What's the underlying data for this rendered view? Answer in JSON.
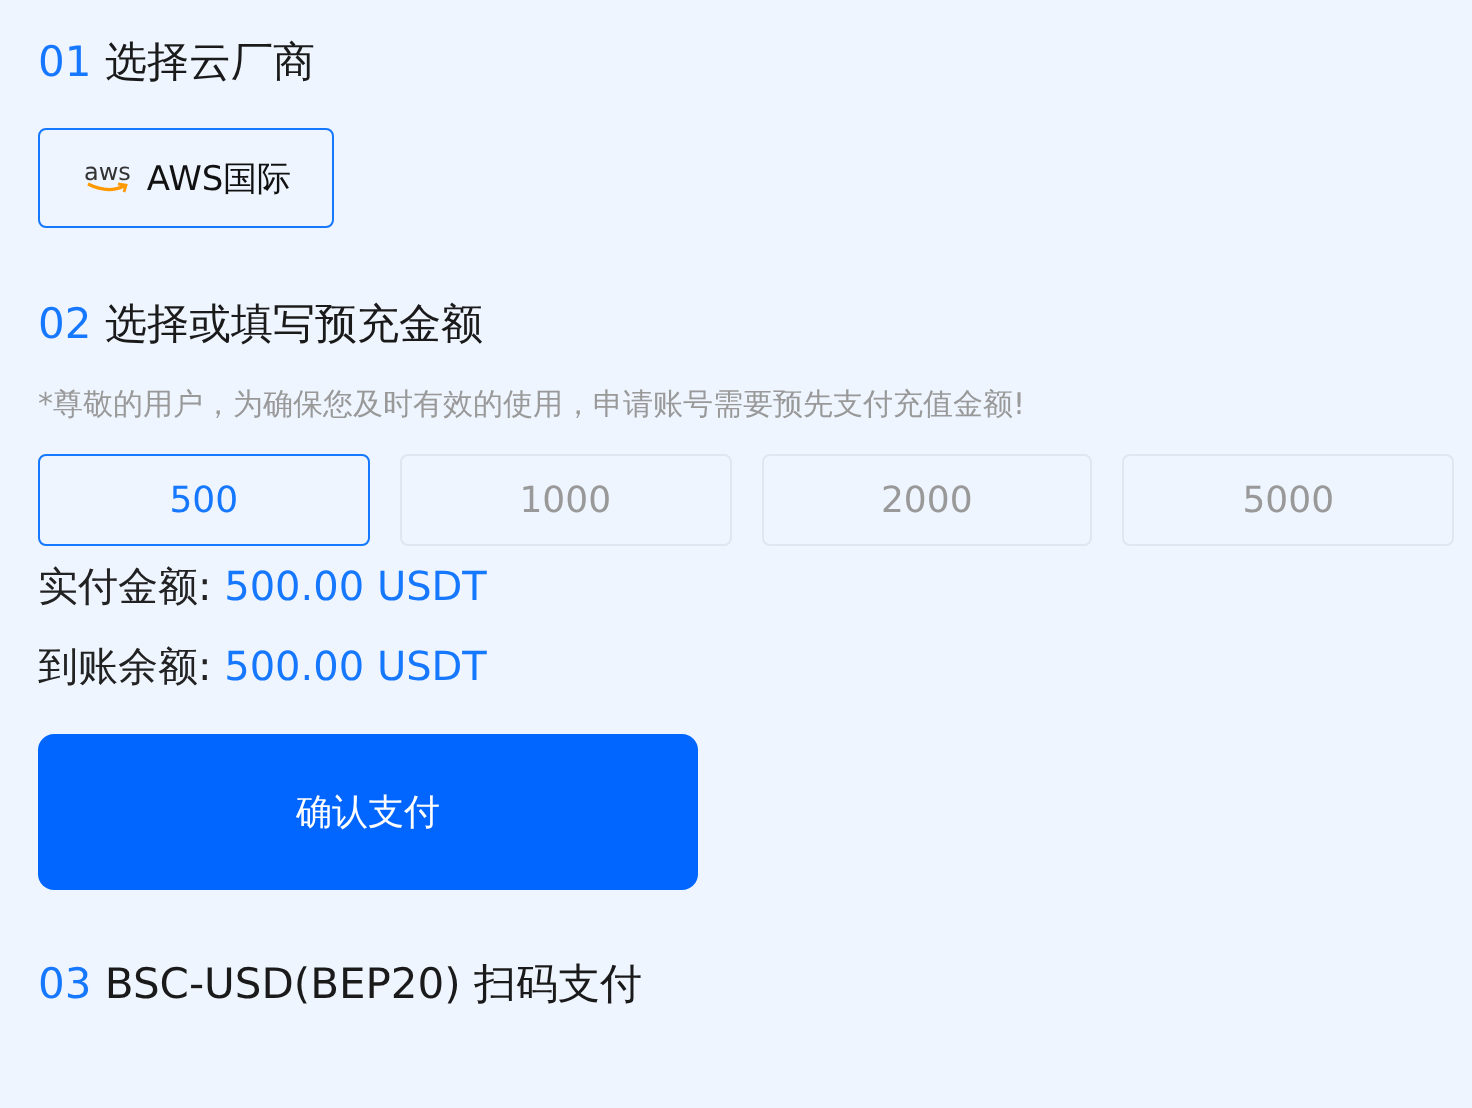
{
  "sections": [
    {
      "number": "01",
      "title": "选择云厂商"
    },
    {
      "number": "02",
      "title": "选择或填写预充金额"
    },
    {
      "number": "03",
      "title": "BSC-USD(BEP20) 扫码支付"
    }
  ],
  "providers": [
    {
      "logo_text": "aws",
      "label": "AWS国际",
      "selected": true
    }
  ],
  "notice": "*尊敬的用户，为确保您及时有效的使用，申请账号需要预先支付充值金额!",
  "amounts": [
    {
      "label": "500",
      "selected": true
    },
    {
      "label": "1000",
      "selected": false
    },
    {
      "label": "2000",
      "selected": false
    },
    {
      "label": "5000",
      "selected": false
    }
  ],
  "summary": [
    {
      "label": "实付金额:",
      "value": "500.00 USDT"
    },
    {
      "label": "到账余额:",
      "value": "500.00 USDT"
    }
  ],
  "confirm_button": "确认支付"
}
